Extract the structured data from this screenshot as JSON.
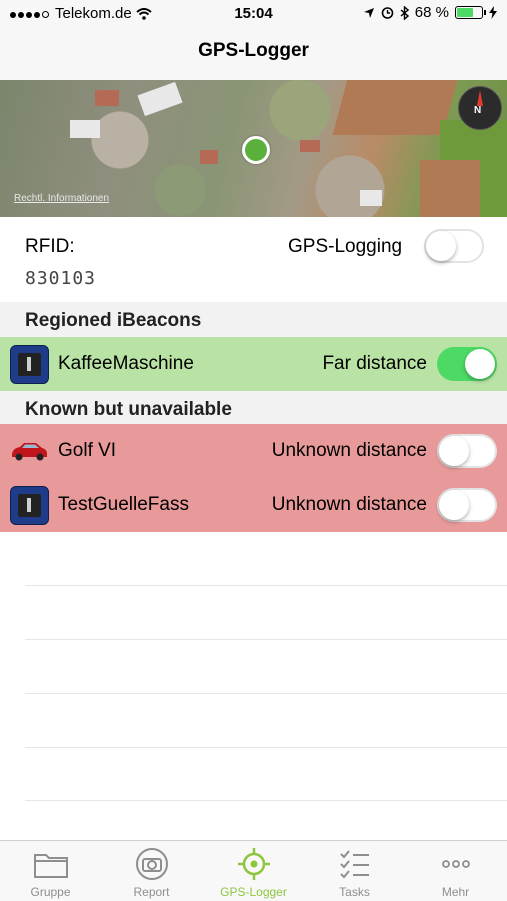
{
  "status_bar": {
    "carrier": "Telekom.de",
    "time": "15:04",
    "battery_percent": "68 %",
    "battery_level": 0.68
  },
  "nav": {
    "title": "GPS-Logger"
  },
  "map": {
    "legal_link": "Rechtl. Informationen",
    "compass_letter": "N"
  },
  "rfid": {
    "label": "RFID:",
    "value": "830103"
  },
  "gps_logging": {
    "label": "GPS-Logging",
    "on": false
  },
  "sections": {
    "regioned": "Regioned iBeacons",
    "unavailable": "Known but unavailable"
  },
  "regioned_beacons": [
    {
      "name": "KaffeeMaschine",
      "distance": "Far distance",
      "icon": "beacon-icon",
      "on": true
    }
  ],
  "unavailable_beacons": [
    {
      "name": "Golf VI",
      "distance": "Unknown distance",
      "icon": "car-icon",
      "on": false
    },
    {
      "name": "TestGuelleFass",
      "distance": "Unknown distance",
      "icon": "beacon-icon",
      "on": false
    }
  ],
  "tabs": [
    {
      "label": "Gruppe",
      "icon": "folder-icon"
    },
    {
      "label": "Report",
      "icon": "camera-icon"
    },
    {
      "label": "GPS-Logger",
      "icon": "location-icon",
      "active": true
    },
    {
      "label": "Tasks",
      "icon": "checklist-icon"
    },
    {
      "label": "Mehr",
      "icon": "more-icon"
    }
  ],
  "colors": {
    "accent_green": "#4cd964",
    "active_tab": "#8cc63f",
    "row_green": "#b9e3a5",
    "row_red": "#e89a9a"
  }
}
